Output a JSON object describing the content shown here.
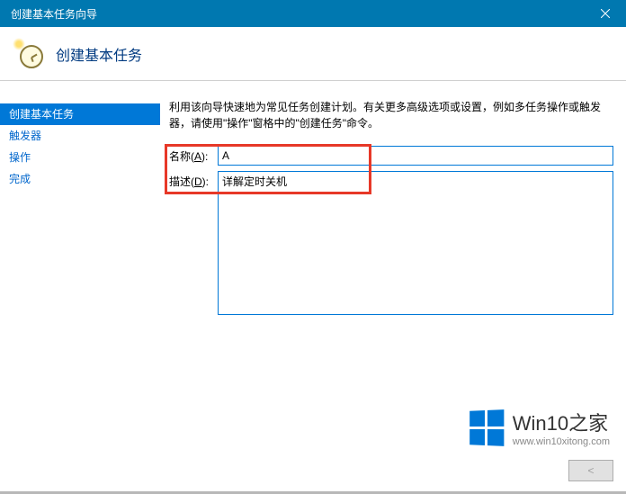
{
  "titlebar": {
    "title": "创建基本任务向导"
  },
  "header": {
    "title": "创建基本任务"
  },
  "sidebar": {
    "items": [
      {
        "label": "创建基本任务",
        "selected": true
      },
      {
        "label": "触发器",
        "selected": false
      },
      {
        "label": "操作",
        "selected": false
      },
      {
        "label": "完成",
        "selected": false
      }
    ]
  },
  "main": {
    "intro": "利用该向导快速地为常见任务创建计划。有关更多高级选项或设置，例如多任务操作或触发器，请使用\"操作\"窗格中的\"创建任务\"命令。",
    "name_label_prefix": "名称(",
    "name_label_key": "A",
    "name_label_suffix": "):",
    "name_value": "A",
    "desc_label_prefix": "描述(",
    "desc_label_key": "D",
    "desc_label_suffix": "):",
    "desc_value": "详解定时关机"
  },
  "footer": {
    "back": "<",
    "next_hidden": "",
    "cancel_hidden": ""
  },
  "watermark": {
    "title": "Win10之家",
    "url": "www.win10xitong.com"
  }
}
